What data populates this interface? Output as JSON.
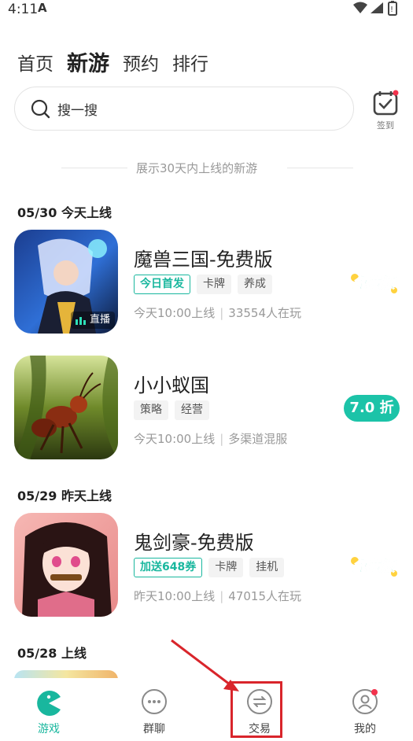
{
  "status_bar": {
    "time": "4:11",
    "app_glyph": "A"
  },
  "top_tabs": [
    {
      "label": "首页",
      "active": false
    },
    {
      "label": "新游",
      "active": true
    },
    {
      "label": "预约",
      "active": false
    },
    {
      "label": "排行",
      "active": false
    }
  ],
  "search": {
    "placeholder": "搜一搜"
  },
  "signin": {
    "label": "签到"
  },
  "divider": {
    "text": "展示30天内上线的新游"
  },
  "sections": [
    {
      "date": "05/30 今天上线",
      "games": [
        {
          "name": "魔兽三国-免费版",
          "tags": [
            {
              "text": "今日首发",
              "highlight": true
            },
            {
              "text": "卡牌"
            },
            {
              "text": "养成"
            }
          ],
          "time": "今天10:00上线",
          "info": "33554人在玩",
          "badge_type": "free",
          "badge_text": "免费版",
          "live": "直播"
        },
        {
          "name": "小小蚁国",
          "tags": [
            {
              "text": "策略"
            },
            {
              "text": "经营"
            }
          ],
          "time": "今天10:00上线",
          "info": "多渠道混服",
          "badge_type": "discount",
          "badge_text": "7.0 折"
        }
      ]
    },
    {
      "date": "05/29 昨天上线",
      "games": [
        {
          "name": "鬼剑豪-免费版",
          "tags": [
            {
              "text": "加送648券",
              "highlight": true
            },
            {
              "text": "卡牌"
            },
            {
              "text": "挂机"
            }
          ],
          "time": "昨天10:00上线",
          "info": "47015人在玩",
          "badge_type": "free",
          "badge_text": "免费版"
        }
      ]
    },
    {
      "date": "05/28 上线",
      "games": []
    }
  ],
  "bottom_nav": [
    {
      "label": "游戏",
      "icon": "pacman-icon",
      "active": true
    },
    {
      "label": "群聊",
      "icon": "chat-dots-icon",
      "active": false
    },
    {
      "label": "交易",
      "icon": "exchange-icon",
      "active": false
    },
    {
      "label": "我的",
      "icon": "profile-icon",
      "active": false,
      "dot": true
    }
  ],
  "colors": {
    "accent": "#19b79e",
    "annotation": "#d9252b"
  }
}
